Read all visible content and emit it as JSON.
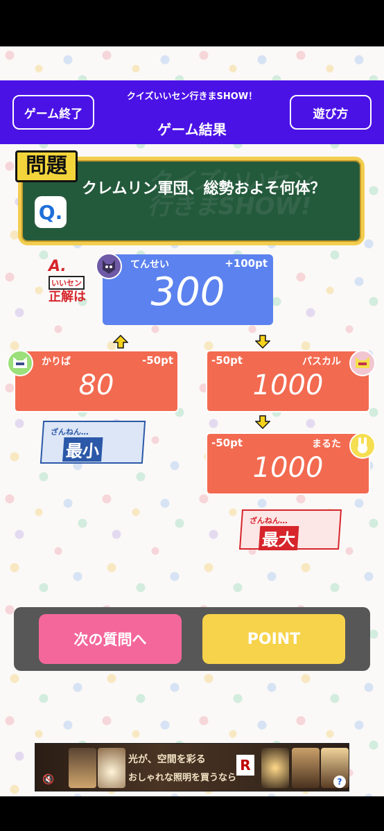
{
  "header": {
    "end_button": "ゲーム終了",
    "how_button": "遊び方",
    "subtitle": "クイズいいセン行きまSHOW！",
    "title": "ゲーム結果"
  },
  "question": {
    "label": "問題",
    "badge": "Q.",
    "text": "クレムリン軍団、総勢およそ何体？",
    "watermark_line1": "クイズいいセン",
    "watermark_line2": "行きまSHOW!"
  },
  "answer_label": {
    "a": "A.",
    "sub": "いいセン",
    "main": "正解は"
  },
  "cards": {
    "correct": {
      "name": "てんせい",
      "points": "+100pt",
      "value": "300",
      "avatar": "wolf-avatar"
    },
    "left": {
      "name": "かりば",
      "points": "-50pt",
      "value": "80",
      "avatar": "cat-avatar"
    },
    "right1": {
      "name": "パスカル",
      "points": "-50pt",
      "value": "1000",
      "avatar": "cat-avatar"
    },
    "right2": {
      "name": "まるた",
      "points": "-50pt",
      "value": "1000",
      "avatar": "rabbit-avatar"
    }
  },
  "badges": {
    "min_top": "ざんねん…",
    "min_main": "最小",
    "max_top": "ざんねん…",
    "max_main": "最大"
  },
  "actions": {
    "next": "次の質問へ",
    "point": "POINT"
  },
  "ad": {
    "line1": "光が、空間を彩る",
    "line2": "おしゃれな照明を買うなら",
    "logo": "R",
    "help": "?"
  },
  "colors": {
    "header": "#4b12e6",
    "correct_card": "#5c82ef",
    "wrong_card": "#f26a50",
    "next_button": "#f4679a",
    "point_button": "#f6d34a",
    "board": "#245a3c",
    "board_border": "#f2cd4f"
  }
}
